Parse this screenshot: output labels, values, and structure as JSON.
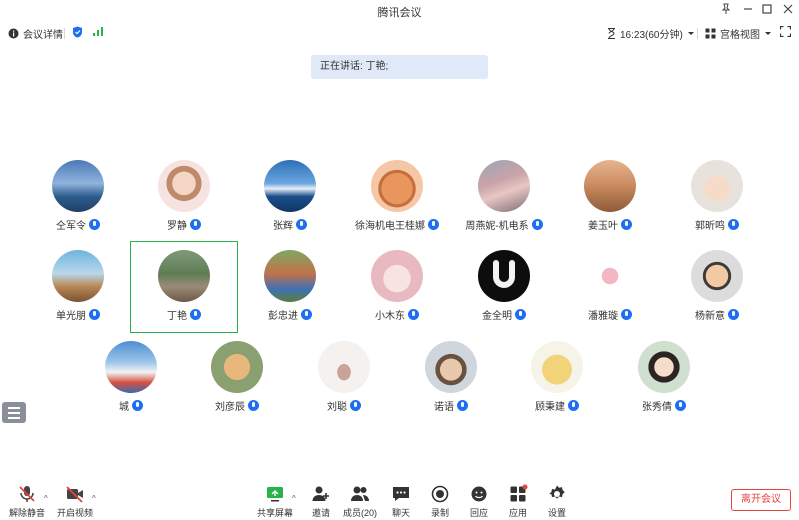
{
  "window": {
    "title": "腾讯会议"
  },
  "infobar": {
    "details_label": "会议详情",
    "timer": "16:23(60分钟)",
    "view_label": "宫格视图"
  },
  "speaking": {
    "text": "正在讲话: 丁艳;"
  },
  "participants": [
    {
      "name": "仝军令"
    },
    {
      "name": "罗静"
    },
    {
      "name": "张辉"
    },
    {
      "name": "徐海机电王桂娜"
    },
    {
      "name": "周燕妮-机电系"
    },
    {
      "name": "姜玉叶"
    },
    {
      "name": "郭昕鸣"
    },
    {
      "name": "单光朋"
    },
    {
      "name": "丁艳"
    },
    {
      "name": "彭忠进"
    },
    {
      "name": "小木东"
    },
    {
      "name": "金全明"
    },
    {
      "name": "潘雅璇"
    },
    {
      "name": "杨新意"
    },
    {
      "name": "城"
    },
    {
      "name": "刘彦辰"
    },
    {
      "name": "刘聪"
    },
    {
      "name": "诺语"
    },
    {
      "name": "顾秉建"
    },
    {
      "name": "张秀倩"
    }
  ],
  "toolbar": {
    "unmute": "解除静音",
    "start_video": "开启视频",
    "share_screen": "共享屏幕",
    "invite": "邀请",
    "members": "成员(20)",
    "chat": "聊天",
    "record": "录制",
    "reaction": "回应",
    "apps": "应用",
    "settings": "设置",
    "leave": "离开会议"
  },
  "colors": {
    "accent": "#1d6ff2",
    "leave": "#e5443c",
    "speaker_outline": "#27b24a",
    "speaking_bg": "#dfe9f7"
  }
}
